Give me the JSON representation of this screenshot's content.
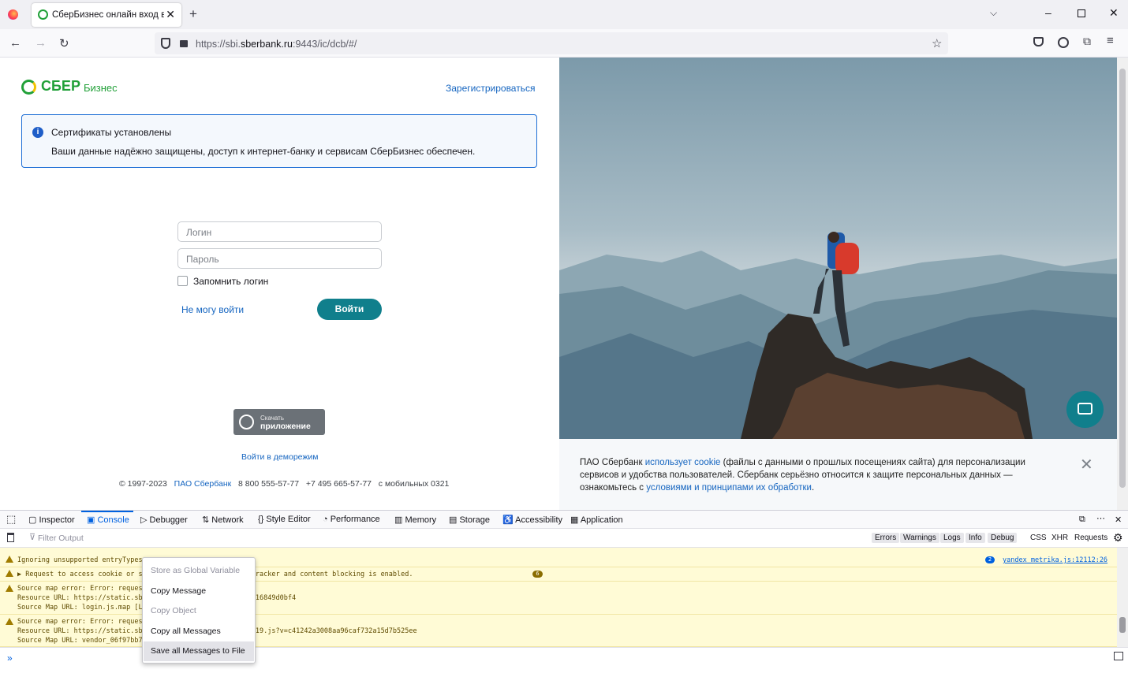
{
  "browser": {
    "tab_title": "СберБизнес онлайн вход в ли",
    "new_tab": "+",
    "url_prefix": "https://sbi.",
    "url_domain": "sberbank.ru",
    "url_suffix": ":9443/ic/dcb/#/"
  },
  "page": {
    "logo_text": "СБЕР",
    "logo_suffix": "Бизнес",
    "register_link": "Зарегистрироваться",
    "notice_title": "Сертификаты установлены",
    "notice_text": "Ваши данные надёжно защищены, доступ к интернет-банку и сервисам СберБизнес обеспечен.",
    "login_placeholder": "Логин",
    "password_placeholder": "Пароль",
    "remember_label": "Запомнить логин",
    "cant_login": "Не могу войти",
    "login_button": "Войти",
    "app_small": "Скачать",
    "app_big": "приложение",
    "demo_link": "Войти в деморежим",
    "footer_copy": "© 1997-2023",
    "footer_bank": "ПАО Сбербанк",
    "footer_phone1": "8 800 555-57-77",
    "footer_phone2": "+7 495 665-57-77",
    "footer_mobile": "с мобильных 0321"
  },
  "cookie": {
    "part1": "ПАО Сбербанк ",
    "link1": "использует cookie",
    "part2": " (файлы с данными о прошлых посещениях сайта) для персонализации сервисов и удобства пользователей. Сбербанк серьёзно относится к защите персональных данных — ознакомьтесь с ",
    "link2": "условиями и принципами их обработки",
    "part3": "."
  },
  "devtools": {
    "tabs": [
      "Inspector",
      "Console",
      "Debugger",
      "Network",
      "Style Editor",
      "Performance",
      "Memory",
      "Storage",
      "Accessibility",
      "Application"
    ],
    "filter_placeholder": "Filter Output",
    "filter_buttons": [
      "Errors",
      "Warnings",
      "Logs",
      "Info",
      "Debug"
    ],
    "type_buttons": [
      "CSS",
      "XHR",
      "Requests"
    ],
    "messages": [
      {
        "lines": [
          "Ignoring unsupported entryTypes"
        ]
      },
      {
        "lines": [
          "▶ Request to access cookie or s                      ed because it came from a tracker and content blocking is enabled."
        ]
      },
      {
        "lines": [
          "Source map error: Error: reques",
          "Resource URL: https://static.sb                      .js?v=d6640297ee50da8ddd46816849d0bf4",
          "Source Map URL: login.js.map [L"
        ]
      },
      {
        "lines": [
          "Source map error: Error: reques",
          "Resource URL: https://static.sb                      s/vendor_06f97bb70e0bc1f89c19.js?v=c41242a3008aa96caf732a15d7b525ee",
          "Source Map URL: vendor_06f97bb7                      ore]"
        ]
      }
    ],
    "source_link": "yandex_metrika.js:12112:26",
    "badge_count_blue": "2",
    "badge_count_brown": "6"
  },
  "context_menu": {
    "items": [
      "Store as Global Variable",
      "Copy Message",
      "Copy Object",
      "Copy all Messages",
      "Save all Messages to File"
    ]
  }
}
